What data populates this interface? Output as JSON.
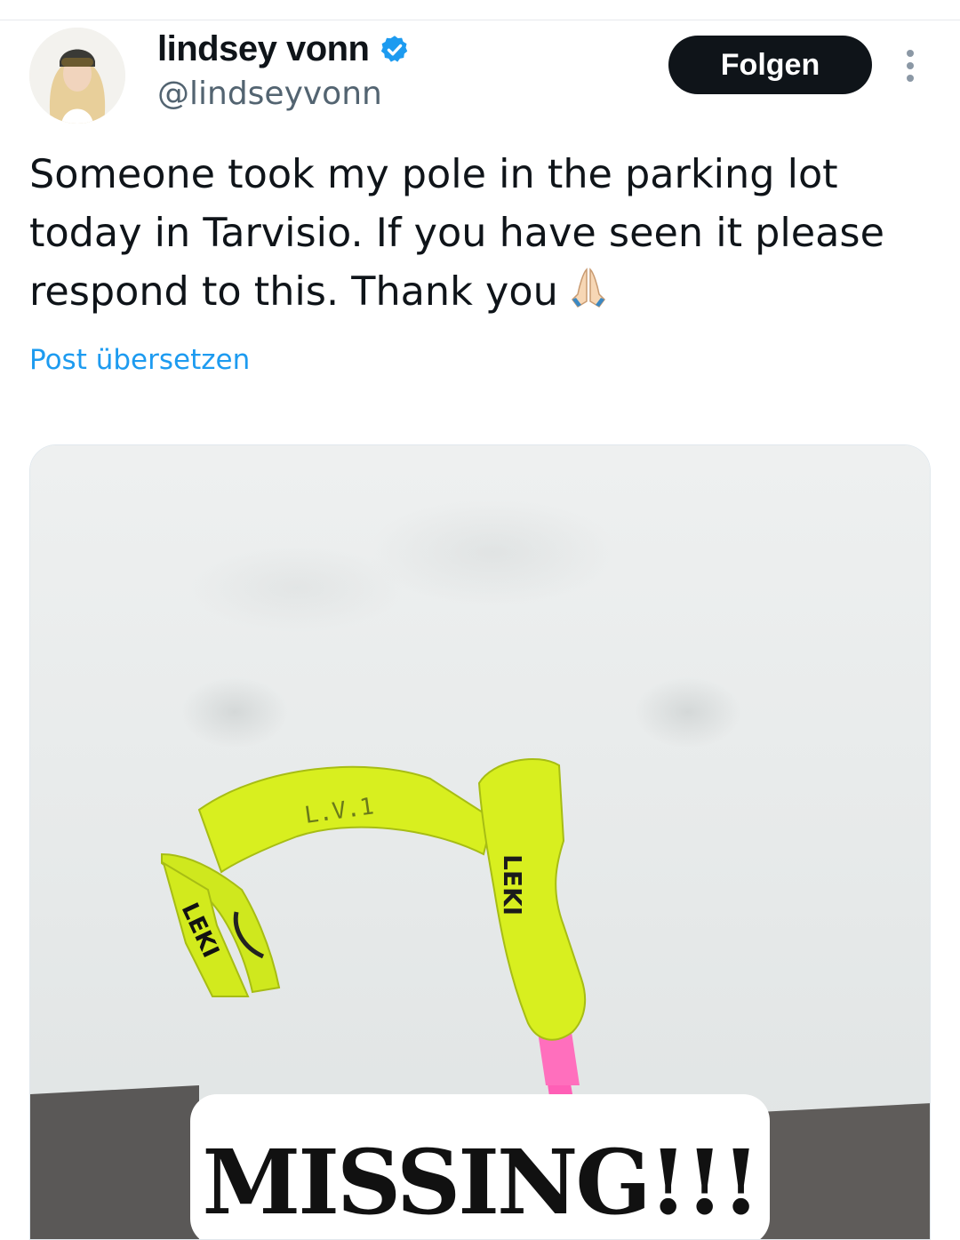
{
  "author": {
    "display_name": "lindsey vonn",
    "handle": "@lindseyvonn",
    "verified_icon": "verified-badge-icon",
    "verified_color": "#1d9bf0"
  },
  "actions": {
    "follow_label": "Folgen",
    "more_icon": "more-vertical-icon"
  },
  "tweet": {
    "text": "Someone took my pole in the parking lot today in Tarvisio. If you have seen it please respond to this. Thank you",
    "emoji": "🙏🏻",
    "translate_label": "Post übersetzen"
  },
  "media": {
    "strap_text": "L.V.1",
    "grip_brand": "LEKI",
    "caption_text": "MISSING!!!"
  },
  "colors": {
    "accent": "#1d9bf0",
    "text": "#0f1419",
    "secondary": "#536471",
    "pole_yellow": "#d8ef1f",
    "pole_pink": "#ff5fb6"
  }
}
